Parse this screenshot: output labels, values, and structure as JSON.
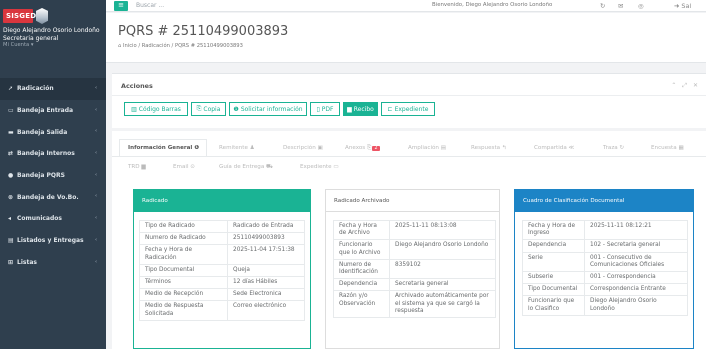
{
  "sidebar": {
    "logo_text": "SISGED",
    "user_name": "Diego Alejandro Osorio Londoño",
    "user_role": "Secretaria general",
    "user_menu": "Mi Cuenta ▾",
    "items": [
      {
        "label": "Radicación",
        "icon": "send-icon"
      },
      {
        "label": "Bandeja Entrada",
        "icon": "inbox-icon"
      },
      {
        "label": "Bandeja Salida",
        "icon": "outbox-icon"
      },
      {
        "label": "Bandeja Internos",
        "icon": "exchange-icon"
      },
      {
        "label": "Bandeja PQRS",
        "icon": "question-icon"
      },
      {
        "label": "Bandeja de Vo.Bo.",
        "icon": "check-icon"
      },
      {
        "label": "Comunicados",
        "icon": "bullhorn-icon"
      },
      {
        "label": "Listados y Entregas",
        "icon": "list-icon"
      },
      {
        "label": "Listas",
        "icon": "grid-icon"
      }
    ]
  },
  "topbar": {
    "search_placeholder": "Buscar ...",
    "welcome": "Bienvenido, Diego Alejandro Osorio Londoño",
    "exit_label": "Sal"
  },
  "header": {
    "title": "PQRS # 25110499003893",
    "breadcrumb": "⌂ Inicio  /  Radicación  /  PQRS # 25110499003893"
  },
  "acciones": {
    "title": "Acciones",
    "buttons": [
      {
        "label": "Código Barras",
        "icon": "barcode-icon"
      },
      {
        "label": "Copia",
        "icon": "copy-icon"
      },
      {
        "label": "Solicitar información",
        "icon": "info-icon"
      },
      {
        "label": "PDF",
        "icon": "pdf-icon"
      },
      {
        "label": "Recibo",
        "icon": "receipt-icon"
      },
      {
        "label": "Expediente",
        "icon": "folder-icon"
      }
    ]
  },
  "tabs": {
    "row1": [
      {
        "label": "Información General ❶"
      },
      {
        "label": "Remitente ♟"
      },
      {
        "label": "Descripción ▣"
      },
      {
        "label": "Anexos ⎘",
        "badge": "2"
      },
      {
        "label": "Ampliación ▤"
      },
      {
        "label": "Respuesta ↰"
      },
      {
        "label": "Compartida ≪"
      },
      {
        "label": "Traza ↻"
      },
      {
        "label": "Encuesta ▦"
      }
    ],
    "row2": [
      {
        "label": "TRD ▆"
      },
      {
        "label": "Email ⊙"
      },
      {
        "label": "Guía de Entrega ⛟"
      },
      {
        "label": "Expediente ▭"
      }
    ]
  },
  "cards": {
    "radicado": {
      "title": "Radicado",
      "rows": [
        [
          "Tipo de Radicado",
          "Radicado de Entrada"
        ],
        [
          "Numero de Radicado",
          "25110499003893"
        ],
        [
          "Fecha y Hora de Radicación",
          "2025-11-04 17:51:38"
        ],
        [
          "Tipo Documental",
          "Queja"
        ],
        [
          "Términos",
          "12 días Hábiles"
        ],
        [
          "Medio de Recepción",
          "Sede Electronica"
        ],
        [
          "Medio de Respuesta Solicitada",
          "Correo electrónico"
        ]
      ]
    },
    "archivado": {
      "title": "Radicado Archivado",
      "rows": [
        [
          "Fecha y Hora de Archivo",
          "2025-11-11 08:13:08"
        ],
        [
          "Funcionario que lo Archivo",
          "Diego Alejandro Osorio Londoño"
        ],
        [
          "Numero de Identificación",
          "8359102"
        ],
        [
          "Dependencia",
          "Secretaria general"
        ],
        [
          "Razón y/o Observación",
          "Archivado automáticamente por el sistema ya que se cargó la respuesta"
        ]
      ]
    },
    "clasificacion": {
      "title": "Cuadro de Clasificación Documental",
      "rows": [
        [
          "Fecha y Hora de Ingreso",
          "2025-11-11 08:12:21"
        ],
        [
          "Dependencia",
          "102 - Secretaria general"
        ],
        [
          "Serie",
          "001 - Consecutivo de Comunicaciones Oficiales"
        ],
        [
          "Subserie",
          "001 - Correspondencia"
        ],
        [
          "Tipo Documental",
          "Correspondencia Entrante"
        ],
        [
          "Funcionario que lo Clasifico",
          "Diego Alejandro Osorio Londoño"
        ]
      ]
    }
  }
}
